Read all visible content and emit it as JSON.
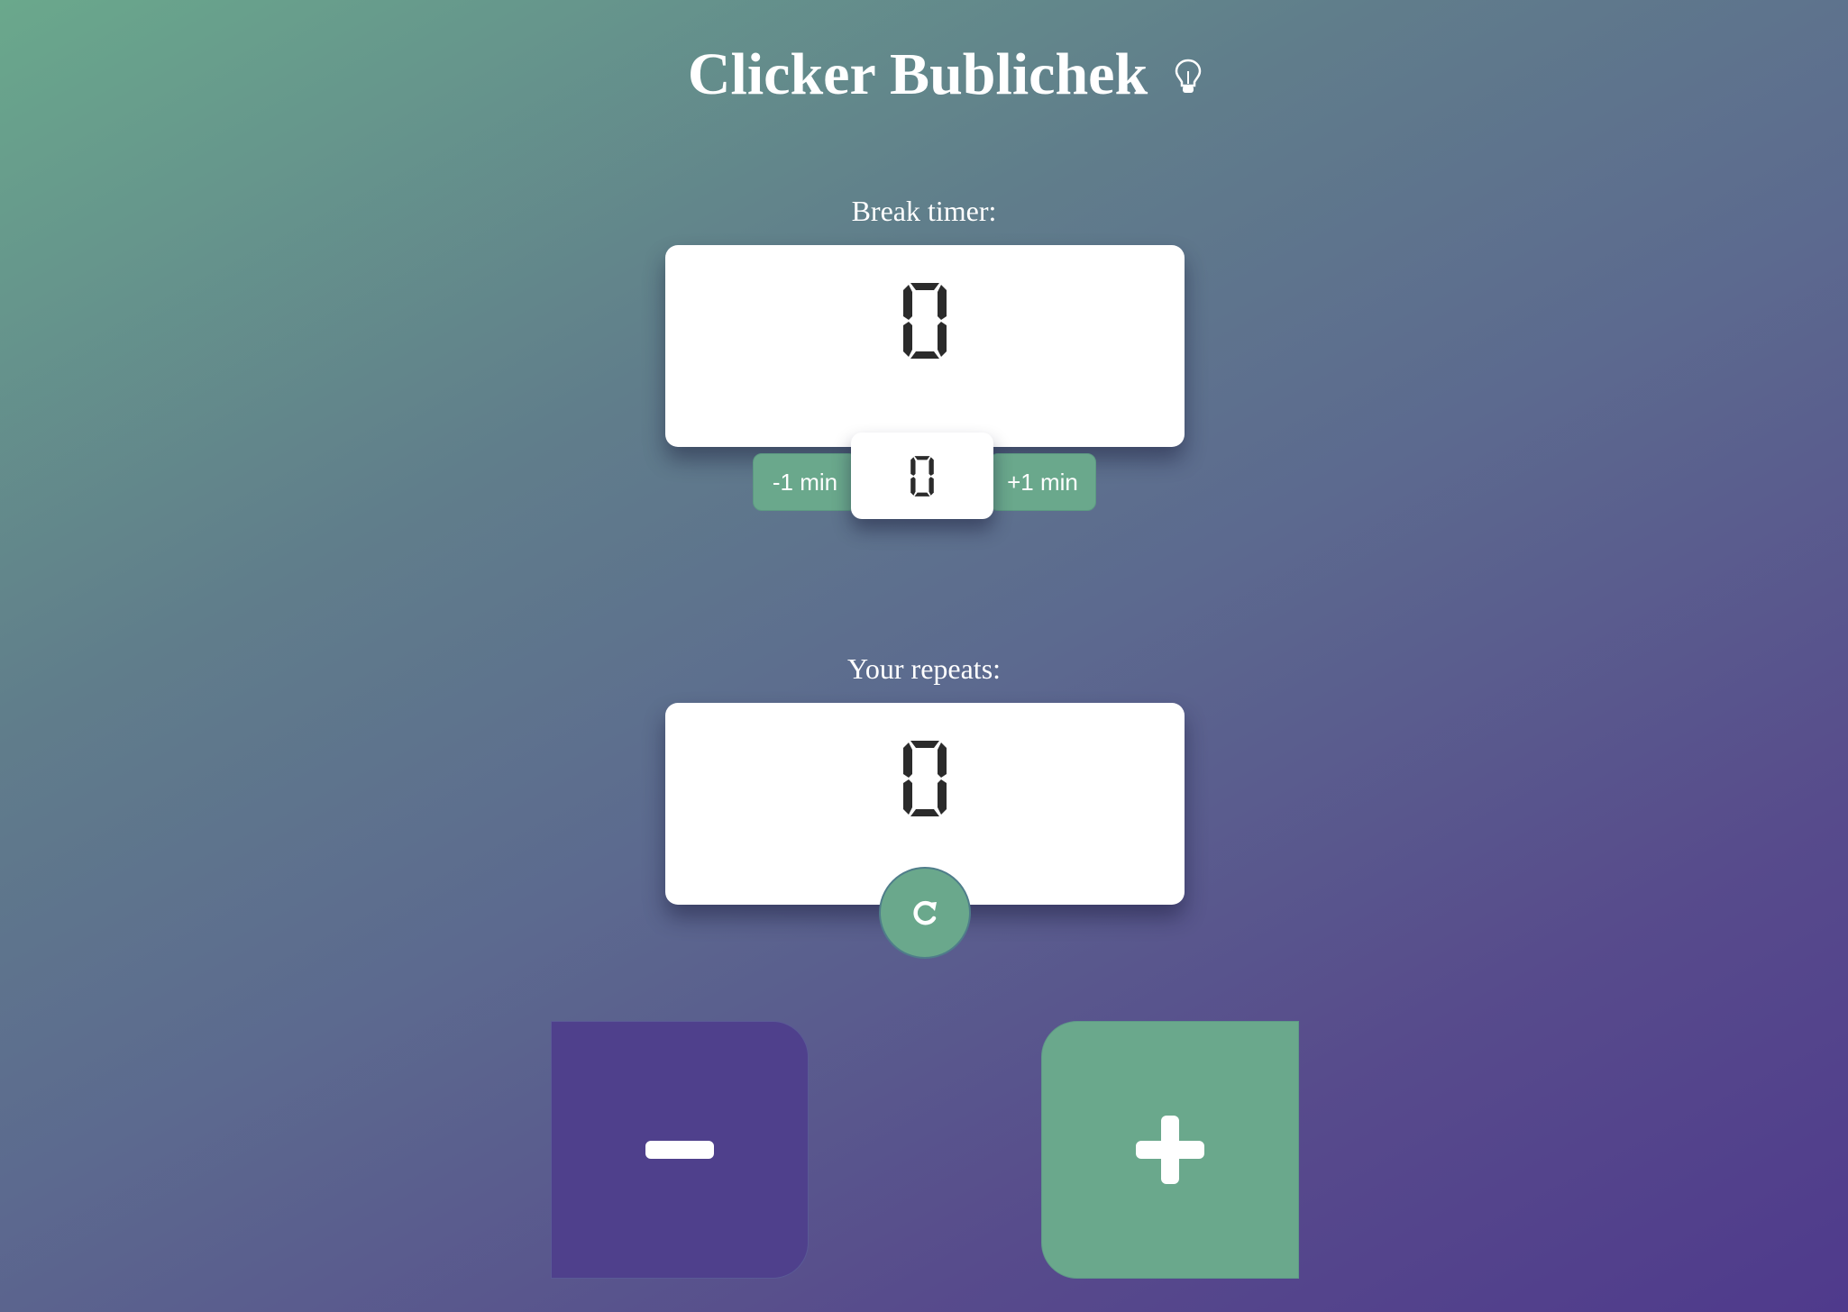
{
  "app": {
    "title": "Clicker Bublichek",
    "theme_toggle_icon": "lightbulb-icon"
  },
  "colors": {
    "accent_green": "#6aa88c",
    "accent_purple": "#4f408c",
    "panel_bg": "#ffffff",
    "digit_color": "#2b2b2b"
  },
  "break_timer": {
    "label": "Break timer:",
    "value": "0",
    "minutes": "0",
    "decrease_label": "-1 min",
    "increase_label": "+1 min"
  },
  "repeats": {
    "label": "Your repeats:",
    "value": "0",
    "reset_icon": "reset-icon"
  },
  "controls": {
    "decrement_icon": "minus-icon",
    "increment_icon": "plus-icon"
  }
}
